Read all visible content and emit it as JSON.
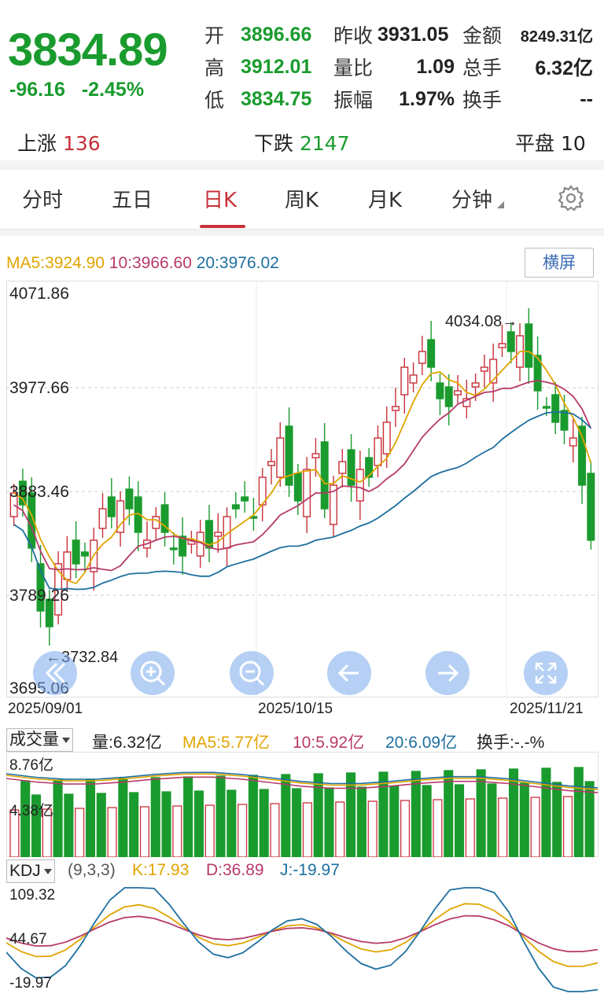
{
  "quote": {
    "price": "3834.89",
    "change": "-96.16",
    "change_pct": "-2.45%",
    "open_label": "开",
    "open": "3896.66",
    "prev_close_label": "昨收",
    "prev_close": "3931.05",
    "amount_label": "金额",
    "amount": "8249.31亿",
    "high_label": "高",
    "high": "3912.01",
    "vol_ratio_label": "量比",
    "vol_ratio": "1.09",
    "total_vol_label": "总手",
    "total_vol": "6.32亿",
    "low_label": "低",
    "low": "3834.75",
    "amplitude_label": "振幅",
    "amplitude": "1.97%",
    "turnover_label": "换手",
    "turnover": "--"
  },
  "breadth": {
    "up_label": "上涨",
    "up": "136",
    "down_label": "下跌",
    "down": "2147",
    "flat_label": "平盘",
    "flat": "10"
  },
  "tabs": [
    {
      "label": "分时"
    },
    {
      "label": "五日"
    },
    {
      "label": "日K"
    },
    {
      "label": "周K"
    },
    {
      "label": "月K"
    },
    {
      "label": "分钟"
    }
  ],
  "active_tab": "日K",
  "kline": {
    "ma5": "MA5:3924.90",
    "ma10": "10:3966.60",
    "ma20": "20:3976.02",
    "landscape_button": "横屏",
    "y_ticks": [
      "4071.86",
      "3977.66",
      "3883.46",
      "3789.26",
      "3695.06"
    ],
    "high_marker": "4034.08",
    "low_marker": "3732.84",
    "dates": [
      "2025/09/01",
      "2025/10/15",
      "2025/11/21"
    ]
  },
  "volume": {
    "selector": "成交量",
    "vol": "量:6.32亿",
    "ma5": "MA5:5.77亿",
    "ma10": "10:5.92亿",
    "ma20": "20:6.09亿",
    "turnover": "换手:-.-%",
    "y_ticks": [
      "8.76亿",
      "4.38亿"
    ]
  },
  "kdj": {
    "selector": "KDJ",
    "params": "(9,3,3)",
    "k": "K:17.93",
    "d": "D:36.89",
    "j": "J:-19.97",
    "y_ticks": [
      "109.32",
      "44.67",
      "-19.97"
    ]
  },
  "colors": {
    "up": "#c8313a",
    "down": "#1a9b2e",
    "ma5": "#e0a400",
    "ma10": "#b73a6a",
    "ma20": "#1e6f9f"
  }
}
